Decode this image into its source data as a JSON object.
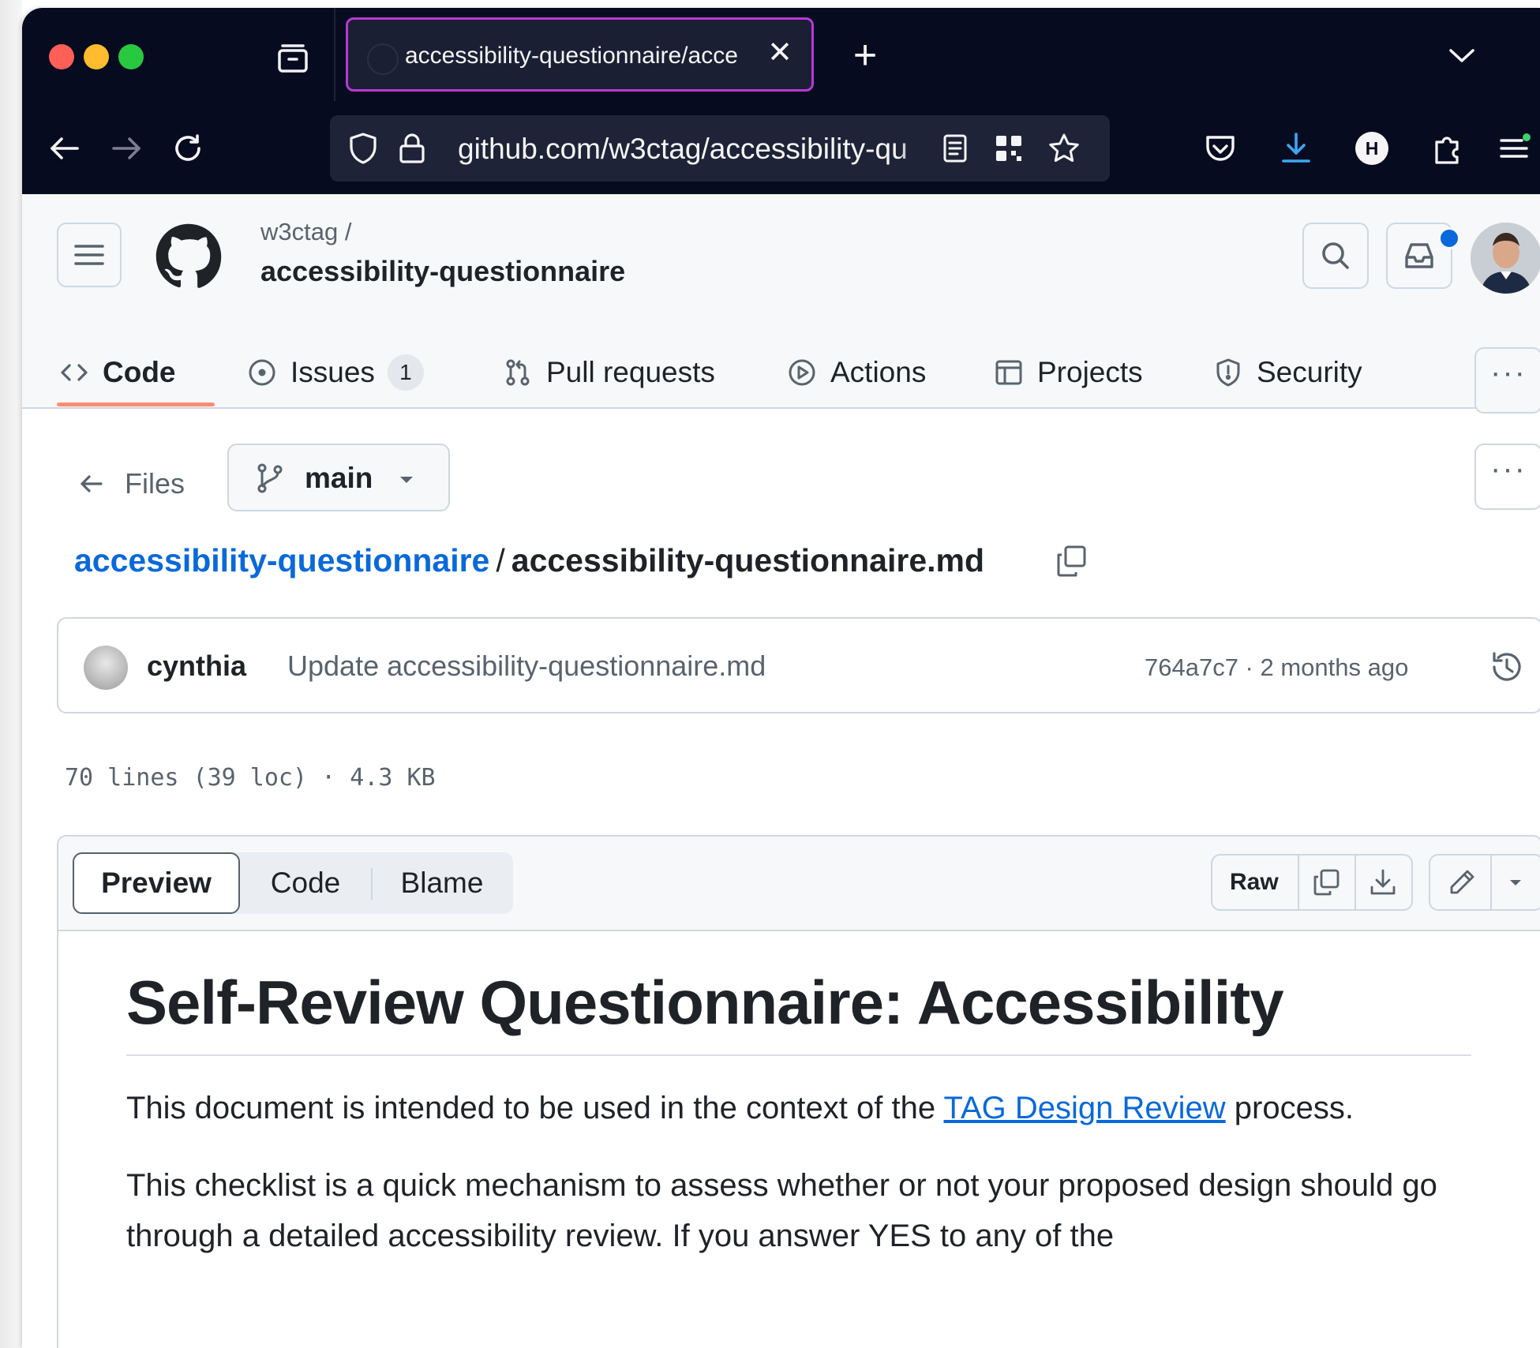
{
  "browser": {
    "tab_title": "accessibility-questionnaire/acce",
    "tab_close": "✕",
    "new_tab": "+",
    "url": "github.com/w3ctag/accessibility-qu",
    "colors": {
      "chrome_bg": "#070b1f",
      "tab_border": "#b838d8",
      "urlbar_bg": "#1f2337",
      "download_accent": "#3ba7f5"
    }
  },
  "header": {
    "owner": "w3ctag /",
    "repo": "accessibility-questionnaire"
  },
  "repo_nav": {
    "items": [
      {
        "label": "Code",
        "icon": "code-icon",
        "selected": true
      },
      {
        "label": "Issues",
        "icon": "issue-opened-icon",
        "count": "1"
      },
      {
        "label": "Pull requests",
        "icon": "git-pull-request-icon"
      },
      {
        "label": "Actions",
        "icon": "play-icon"
      },
      {
        "label": "Projects",
        "icon": "table-icon"
      },
      {
        "label": "Security",
        "icon": "shield-icon"
      }
    ],
    "more": "···"
  },
  "file_nav": {
    "back_label": "Files",
    "branch": "main",
    "more": "···"
  },
  "breadcrumb": {
    "repo_link": "accessibility-questionnaire",
    "separator": "/",
    "file": "accessibility-questionnaire.md"
  },
  "commit": {
    "author": "cynthia",
    "message": "Update accessibility-questionnaire.md",
    "meta": "764a7c7 · 2 months ago"
  },
  "file_stats": "70 lines (39 loc) · 4.3 KB",
  "viewer": {
    "tabs": [
      "Preview",
      "Code",
      "Blame"
    ],
    "raw_label": "Raw"
  },
  "content": {
    "heading": "Self-Review Questionnaire: Accessibility",
    "p1_before": "This document is intended to be used in the context of the ",
    "p1_link": "TAG Design Review",
    "p1_after": " process.",
    "p2": "This checklist is a quick mechanism to assess whether or not your proposed design should go through a detailed accessibility review. If you answer YES to any of the"
  },
  "colors": {
    "link": "#0969da",
    "accent_underline": "#fd8c73",
    "notification_dot": "#0969da"
  }
}
